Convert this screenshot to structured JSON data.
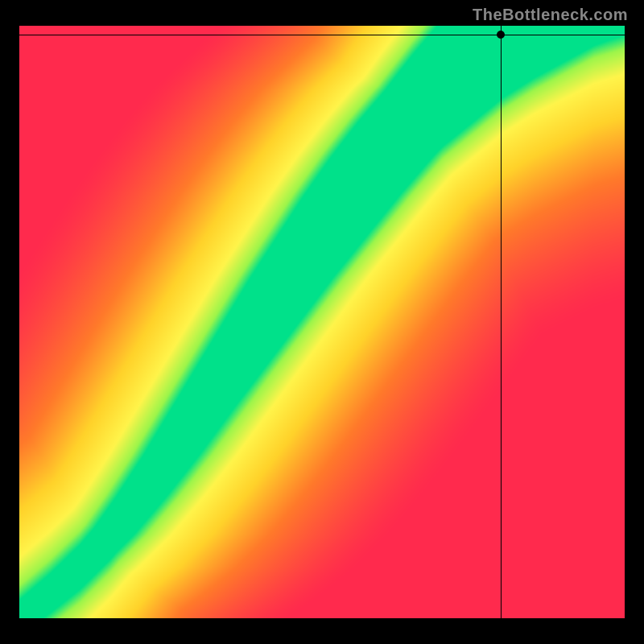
{
  "watermark": "TheBottleneck.com",
  "chart_data": {
    "type": "heatmap",
    "title": "",
    "xlabel": "",
    "ylabel": "",
    "xlim": [
      0,
      1
    ],
    "ylim": [
      0,
      1
    ],
    "marker": {
      "x": 0.795,
      "y": 0.985
    },
    "crosshair": {
      "x": 0.795,
      "y": 0.985
    },
    "color_stops": [
      {
        "value": 0.0,
        "color": "#ff2a4d"
      },
      {
        "value": 0.35,
        "color": "#ff7a2a"
      },
      {
        "value": 0.6,
        "color": "#ffd22a"
      },
      {
        "value": 0.8,
        "color": "#fff44a"
      },
      {
        "value": 0.93,
        "color": "#9cf54a"
      },
      {
        "value": 1.0,
        "color": "#00e18a"
      }
    ],
    "ridge_curve_description": "monotone increasing curve from bottom-left corner to top, roughly y ≈ x^0.55 with slight S-bend; green band width ~0.06–0.12 in normalized units",
    "ridge_samples": [
      {
        "x": 0.0,
        "y": 0.0
      },
      {
        "x": 0.05,
        "y": 0.04
      },
      {
        "x": 0.1,
        "y": 0.085
      },
      {
        "x": 0.15,
        "y": 0.14
      },
      {
        "x": 0.2,
        "y": 0.205
      },
      {
        "x": 0.25,
        "y": 0.275
      },
      {
        "x": 0.3,
        "y": 0.35
      },
      {
        "x": 0.35,
        "y": 0.425
      },
      {
        "x": 0.4,
        "y": 0.5
      },
      {
        "x": 0.45,
        "y": 0.575
      },
      {
        "x": 0.5,
        "y": 0.645
      },
      {
        "x": 0.55,
        "y": 0.715
      },
      {
        "x": 0.6,
        "y": 0.78
      },
      {
        "x": 0.65,
        "y": 0.84
      },
      {
        "x": 0.7,
        "y": 0.895
      },
      {
        "x": 0.75,
        "y": 0.94
      },
      {
        "x": 0.8,
        "y": 0.985
      },
      {
        "x": 0.85,
        "y": 1.02
      },
      {
        "x": 0.9,
        "y": 1.05
      },
      {
        "x": 0.95,
        "y": 1.08
      },
      {
        "x": 1.0,
        "y": 1.1
      }
    ],
    "ridge_half_width": 0.055,
    "falloff_scale": 0.45
  }
}
